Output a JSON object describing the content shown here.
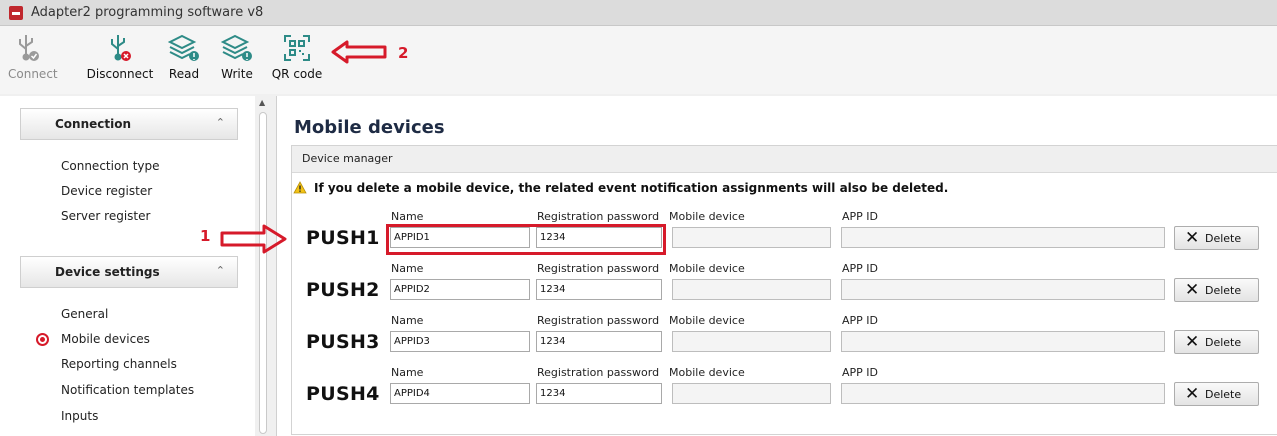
{
  "window": {
    "title": "Adapter2 programming software v8"
  },
  "toolbar": {
    "connect": "Connect",
    "disconnect": "Disconnect",
    "read": "Read",
    "write": "Write",
    "qr_code": "QR code"
  },
  "sidebar": {
    "groups": [
      {
        "title": "Connection",
        "items": [
          "Connection type",
          "Device register",
          "Server register"
        ]
      },
      {
        "title": "Device settings",
        "items": [
          "General",
          "Mobile devices",
          "Reporting channels",
          "Notification templates",
          "Inputs"
        ]
      }
    ],
    "selected": "Mobile devices"
  },
  "main": {
    "title": "Mobile devices",
    "panel_title": "Device manager",
    "warning": "If you delete a mobile device, the related event notification assignments will also be deleted.",
    "columns": {
      "name": "Name",
      "password": "Registration password",
      "mobile": "Mobile device",
      "app_id": "APP ID"
    },
    "delete_label": "Delete",
    "rows": [
      {
        "label": "PUSH1",
        "name": "APPID1",
        "password": "1234",
        "mobile": "",
        "app_id": ""
      },
      {
        "label": "PUSH2",
        "name": "APPID2",
        "password": "1234",
        "mobile": "",
        "app_id": ""
      },
      {
        "label": "PUSH3",
        "name": "APPID3",
        "password": "1234",
        "mobile": "",
        "app_id": ""
      },
      {
        "label": "PUSH4",
        "name": "APPID4",
        "password": "1234",
        "mobile": "",
        "app_id": ""
      }
    ]
  },
  "annotations": {
    "arrow1": "1",
    "arrow2": "2",
    "color": "#d61a2a"
  },
  "colors": {
    "accent": "#d61a2a",
    "title_text": "#1e2b44"
  }
}
